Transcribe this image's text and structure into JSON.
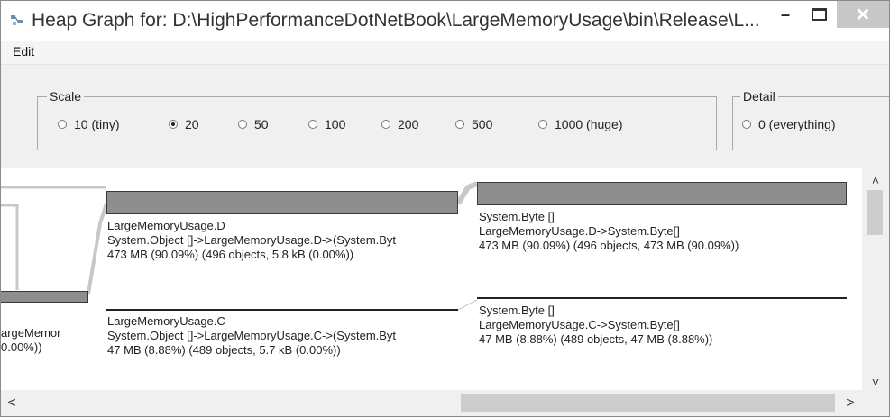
{
  "window": {
    "title": "Heap Graph for: D:\\HighPerformanceDotNetBook\\LargeMemoryUsage\\bin\\Release\\L...",
    "minimize_glyph": "–",
    "close_glyph": "✕"
  },
  "menu": {
    "edit": "Edit"
  },
  "scale": {
    "legend": "Scale",
    "options": [
      "10 (tiny)",
      "20",
      "50",
      "100",
      "200",
      "500",
      "1000 (huge)"
    ],
    "selected": "20"
  },
  "detail": {
    "legend": "Detail",
    "options": [
      "0 (everything)"
    ]
  },
  "graph": {
    "nodes": [
      {
        "lines": [
          "LargeMemoryUsage.D",
          "System.Object []->LargeMemoryUsage.D->(System.Byt",
          " 473 MB   (90.09%)  (496 objects,  5.8 kB   (0.00%))"
        ]
      },
      {
        "lines": [
          "LargeMemoryUsage.C",
          "System.Object []->LargeMemoryUsage.C->(System.Byt",
          " 47 MB   (8.88%)  (489 objects,  5.7 kB   (0.00%))"
        ]
      },
      {
        "lines": [
          "System.Byte []",
          "LargeMemoryUsage.D->System.Byte[]",
          " 473 MB   (90.09%)  (496 objects,  473 MB   (90.09%))"
        ]
      },
      {
        "lines": [
          "System.Byte []",
          "LargeMemoryUsage.C->System.Byte[]",
          " 47 MB   (8.88%)  (489 objects,  47 MB   (8.88%))"
        ]
      },
      {
        "lines": [
          "argeMemor",
          "0.00%))"
        ]
      }
    ]
  },
  "scrollbars": {
    "up": "˄",
    "down": "˅",
    "left": "<",
    "right": ">"
  }
}
